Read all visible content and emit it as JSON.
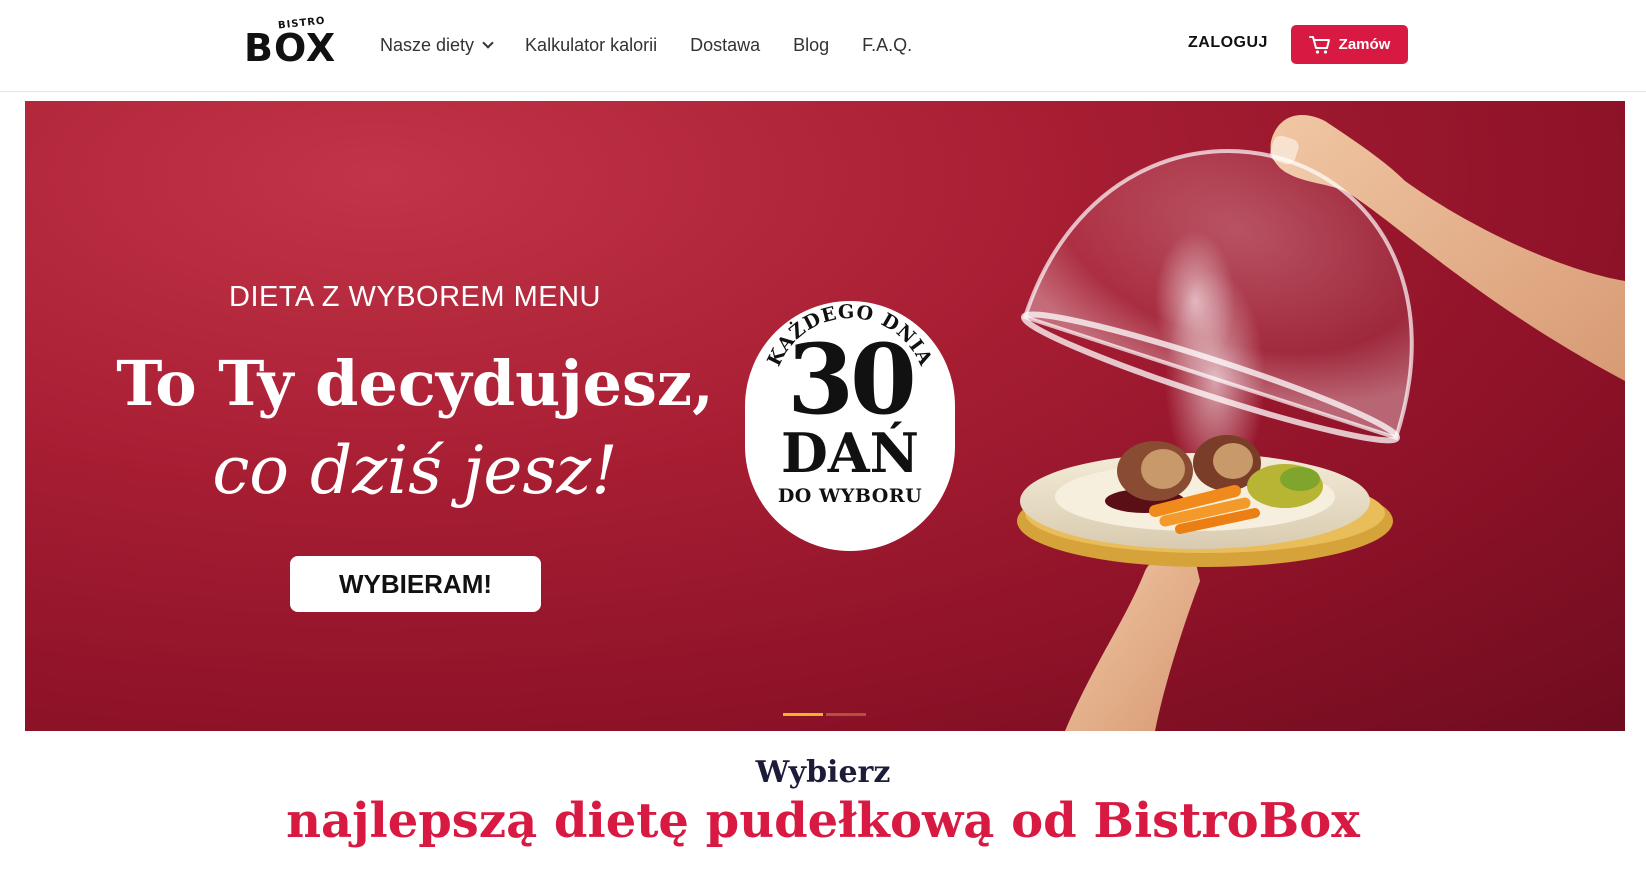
{
  "header": {
    "logo_small": "BISTRO",
    "logo_main": "BOX",
    "nav": [
      {
        "label": "Nasze diety",
        "has_dropdown": true
      },
      {
        "label": "Kalkulator kalorii"
      },
      {
        "label": "Dostawa"
      },
      {
        "label": "Blog"
      },
      {
        "label": "F.A.Q."
      }
    ],
    "login_label": "ZALOGUJ",
    "order_label": "Zamów",
    "order_icon": "cart-icon",
    "brand_color": "#d81a43"
  },
  "hero": {
    "eyebrow": "DIETA Z WYBOREM MENU",
    "title": "To Ty decydujesz,",
    "script": "co dziś jesz!",
    "cta_label": "WYBIERAM!",
    "badge": {
      "arc": "KAŻDEGO DNIA",
      "number": "30",
      "word": "DAŃ",
      "sub": "DO WYBORU"
    },
    "slides": [
      {
        "active": true,
        "color": "#f0b429"
      },
      {
        "active": false,
        "color": "#b5513a"
      }
    ],
    "background": "#a81e33"
  },
  "section": {
    "kicker": "Wybierz",
    "title": "najlepszą dietę pudełkową od BistroBox"
  }
}
